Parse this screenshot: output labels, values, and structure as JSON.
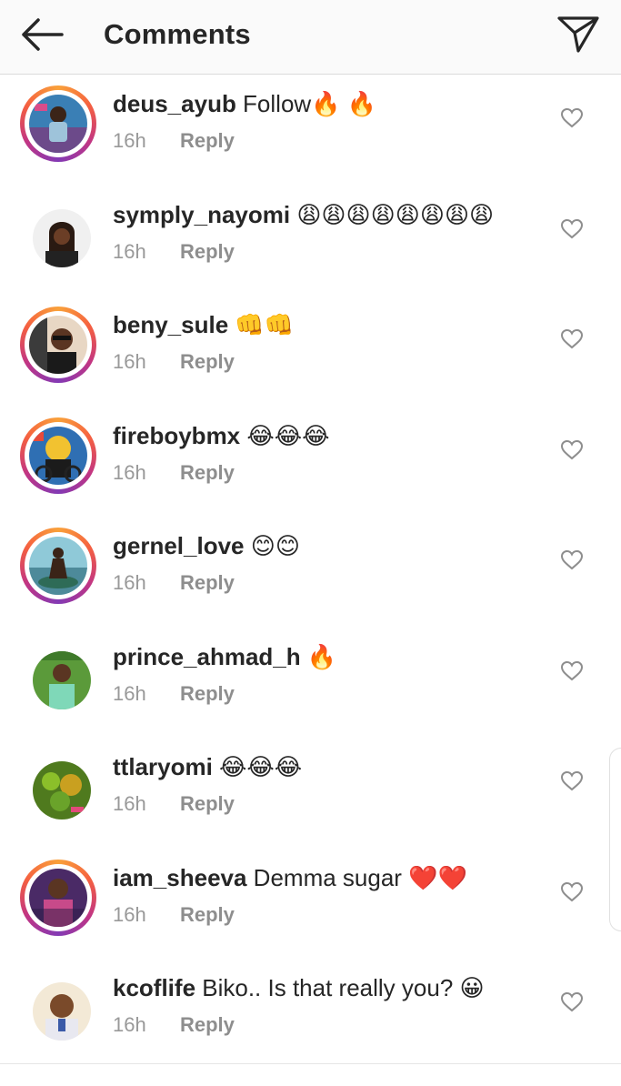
{
  "header": {
    "title": "Comments"
  },
  "comments": [
    {
      "username": "deus_ayub",
      "text": " Follow🔥 🔥",
      "time": "16h",
      "reply": "Reply",
      "story": true,
      "avatar": "a1"
    },
    {
      "username": "symply_nayomi",
      "text": " 😩😩😩😩😩😩😩😩",
      "time": "16h",
      "reply": "Reply",
      "story": false,
      "avatar": "a2"
    },
    {
      "username": "beny_sule",
      "text": " 👊👊",
      "time": "16h",
      "reply": "Reply",
      "story": true,
      "avatar": "a3"
    },
    {
      "username": "fireboybmx",
      "text": " 😂😂😂",
      "time": "16h",
      "reply": "Reply",
      "story": true,
      "avatar": "a4"
    },
    {
      "username": "gernel_love",
      "text": " 😊😊",
      "time": "16h",
      "reply": "Reply",
      "story": true,
      "avatar": "a5"
    },
    {
      "username": "prince_ahmad_h",
      "text": " 🔥",
      "time": "16h",
      "reply": "Reply",
      "story": false,
      "avatar": "a6"
    },
    {
      "username": "ttlaryomi",
      "text": " 😂😂😂",
      "time": "16h",
      "reply": "Reply",
      "story": false,
      "avatar": "a7"
    },
    {
      "username": "iam_sheeva",
      "text": " Demma sugar ❤️❤️",
      "time": "16h",
      "reply": "Reply",
      "story": true,
      "avatar": "a8"
    },
    {
      "username": "kcoflife",
      "text": " Biko.. Is that really you? 😀",
      "time": "16h",
      "reply": "Reply",
      "story": false,
      "avatar": "a9"
    }
  ],
  "icons": {
    "back": "arrow-left-icon",
    "send": "paper-plane-icon",
    "like": "heart-outline-icon"
  }
}
